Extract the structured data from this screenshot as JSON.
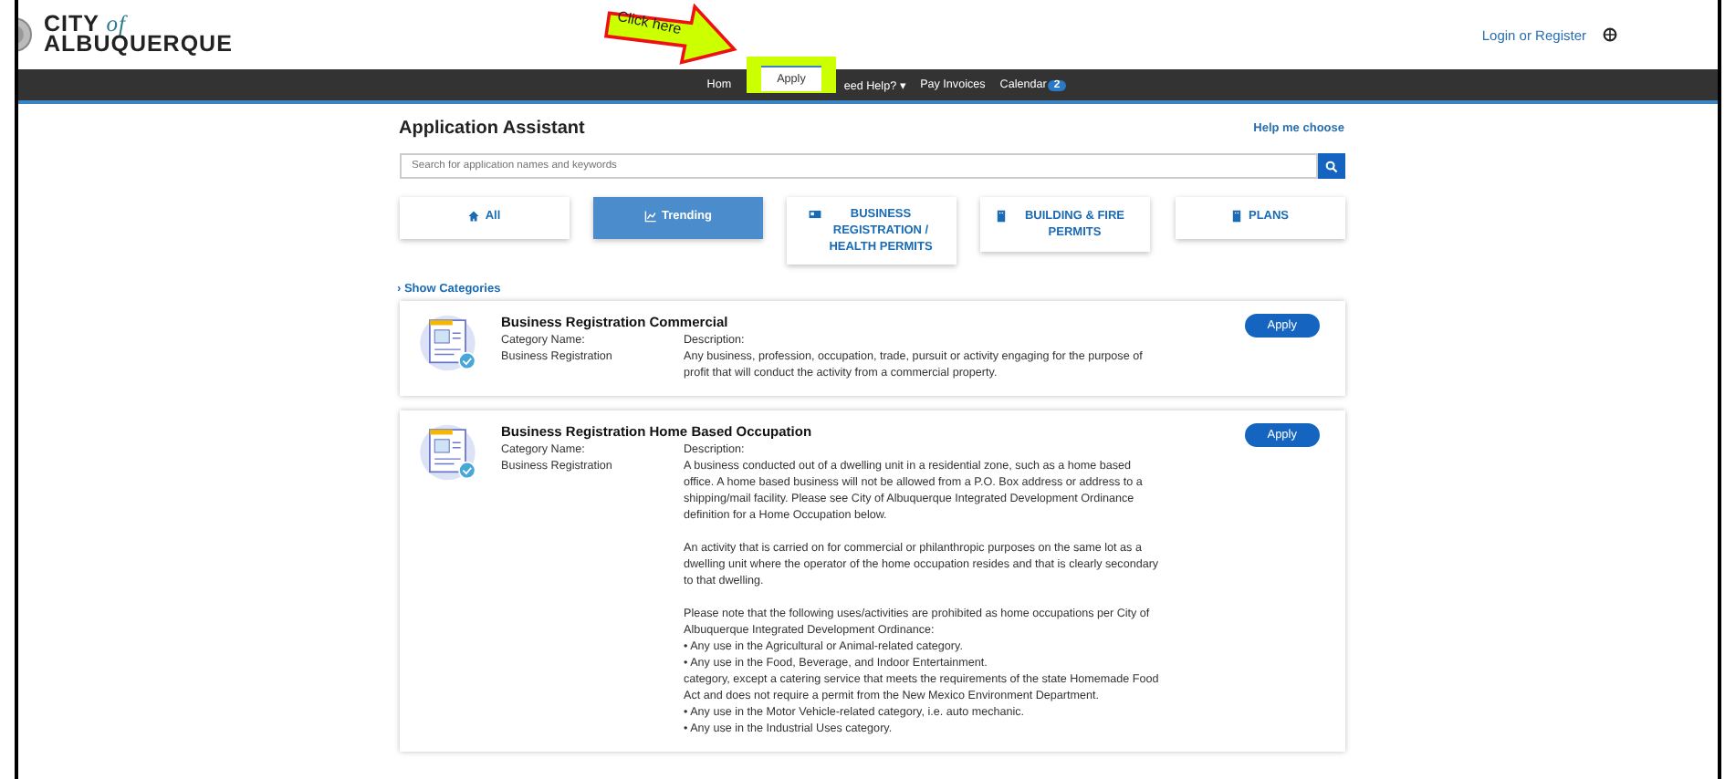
{
  "header": {
    "logo_line1": "CITY",
    "logo_of": "of",
    "logo_line2": "ALBUQUERQUE",
    "login": "Login or Register"
  },
  "annotation": {
    "callout": "Click here"
  },
  "nav": [
    {
      "label": "Hom",
      "selected": false
    },
    {
      "label": "Apply",
      "selected": true
    },
    {
      "label": "eed Help?",
      "selected": false,
      "caret": "▾"
    },
    {
      "label": "Pay Invoices",
      "selected": false
    },
    {
      "label": "Calendar",
      "selected": false,
      "badge": "2"
    }
  ],
  "title": "Application Assistant",
  "help_link": "Help me choose",
  "search": {
    "placeholder": "Search for application names and keywords"
  },
  "tabs": [
    {
      "label": "All",
      "selected": false
    },
    {
      "label": "Trending",
      "selected": true
    },
    {
      "label": "BUSINESS REGISTRATION / HEALTH PERMITS",
      "selected": false
    },
    {
      "label": "BUILDING & FIRE PERMITS",
      "selected": false
    },
    {
      "label": "PLANS",
      "selected": false
    }
  ],
  "show_categories": "› Show Categories",
  "results": [
    {
      "title": "Business Registration Commercial",
      "category_label": "Category Name:",
      "category": "Business Registration",
      "description_label": "Description:",
      "button": "Apply",
      "description": [
        [
          "Any business, profession, occupation, trade, pursuit or activity engaging for the purpose of profit that will conduct the activity from a commercial property."
        ]
      ]
    },
    {
      "title": "Business Registration Home Based Occupation",
      "category_label": "Category Name:",
      "category": "Business Registration",
      "description_label": "Description:",
      "button": "Apply",
      "description": [
        [
          "A business conducted out of a dwelling unit in a residential zone, such as a home based office. A home based business will not be allowed from a P.O. Box address or address to a shipping/mail facility. Please see City of Albuquerque Integrated Development Ordinance definition for a Home Occupation below."
        ],
        [
          "An activity that is carried on for commercial or philanthropic purposes on the same lot as a dwelling unit where the operator of the home occupation resides and that is clearly secondary to that dwelling."
        ],
        [
          "Please note that the following uses/activities are prohibited as home occupations per City of Albuquerque Integrated Development Ordinance:",
          "• Any use in the Agricultural or Animal-related category.",
          "• Any use in the Food, Beverage, and Indoor Entertainment.",
          "category, except a catering service that meets the requirements of the state Homemade Food Act and does not require a permit from the New Mexico Environment Department.",
          "• Any use in the Motor Vehicle-related category, i.e. auto mechanic.",
          "• Any use in the Industrial Uses category."
        ]
      ]
    }
  ]
}
